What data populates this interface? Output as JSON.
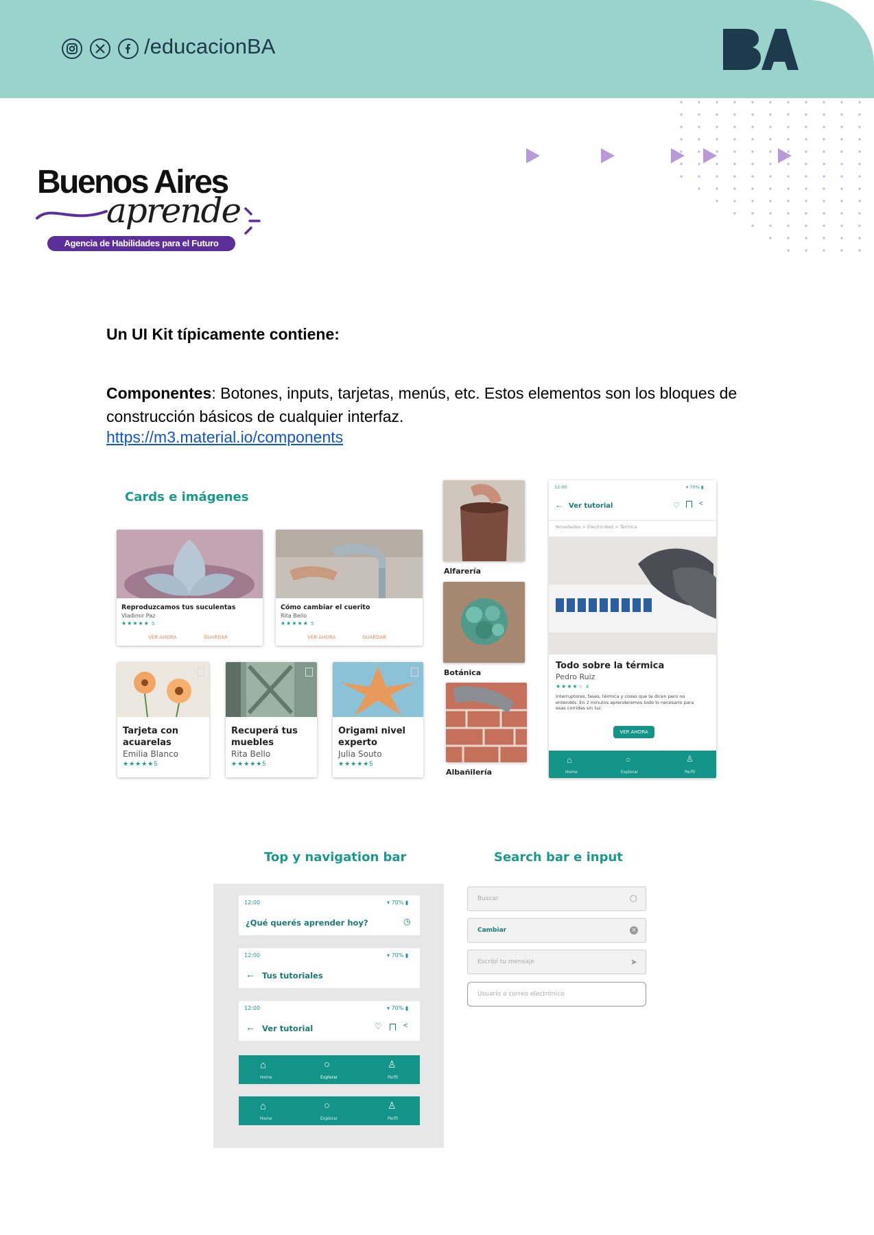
{
  "header": {
    "social_icons": [
      "instagram-icon",
      "x-icon",
      "facebook-icon"
    ],
    "handle": "/educacionBA",
    "logo": "BA"
  },
  "brand": {
    "title": "Buenos Aires",
    "script": "aprende",
    "tagline": "Agencia de Habilidades para el Futuro"
  },
  "content": {
    "heading": "Un UI Kit típicamente contiene:",
    "term": "Componentes",
    "definition": ": Botones, inputs, tarjetas, menús, etc. Estos elementos son los bloques de construcción básicos de cualquier interfaz.",
    "link": "https://m3.material.io/components"
  },
  "cards_section": {
    "title": "Cards e imágenes",
    "wide_cards": [
      {
        "title": "Reproduzcamos tus suculentas",
        "author": "Vladimir Paz",
        "rating": "5",
        "action1": "VER AHORA",
        "action2": "GUARDAR"
      },
      {
        "title": "Cómo cambiar el cuerito",
        "author": "Rita Bello",
        "rating": "5",
        "action1": "VER AHORA",
        "action2": "GUARDAR"
      }
    ],
    "small_cards": [
      {
        "title": "Tarjeta con acuarelas",
        "author": "Emilia Blanco",
        "rating": "5"
      },
      {
        "title": "Recuperá tus muebles",
        "author": "Rita Bello",
        "rating": "5"
      },
      {
        "title": "Origami nivel experto",
        "author": "Julia Souto",
        "rating": "5"
      }
    ],
    "categories": [
      "Alfarería",
      "Botánica",
      "Albañilería"
    ],
    "phone": {
      "time": "12:00",
      "battery": "70%",
      "back_label": "Ver tutorial",
      "breadcrumb": "Novedades > Electricidad > Térmica",
      "title": "Todo sobre la térmica",
      "author": "Pedro Ruiz",
      "rating": "4",
      "description": "Interruptores, fases, térmica y cosas que te dicen pero no entendés. En 2 minutos aprenderemos todo lo necesario para esas corridas sin luz.",
      "button": "VER AHORA",
      "nav": [
        "Home",
        "Explorar",
        "Perfil"
      ]
    }
  },
  "nav_section": {
    "title": "Top y navigation bar",
    "bars": [
      {
        "time": "12:00",
        "battery": "70%",
        "label": "¿Qué querés aprender hoy?"
      },
      {
        "time": "12:00",
        "battery": "70%",
        "label": "Tus tutoriales"
      },
      {
        "time": "12:00",
        "battery": "70%",
        "label": "Ver tutorial"
      }
    ],
    "nav_labels": [
      "Home",
      "Explorar",
      "Perfil"
    ]
  },
  "search_section": {
    "title": "Search bar e input",
    "inputs": [
      {
        "text": "Buscar",
        "icon": "search-icon"
      },
      {
        "text": "Cambiar",
        "icon": "clear-icon"
      },
      {
        "text": "Escribí tu mensaje",
        "icon": "send-icon"
      },
      {
        "text": "Usuario o correo electrónico",
        "icon": ""
      }
    ]
  },
  "colors": {
    "band": "#9ad2cc",
    "navy": "#1e3a4d",
    "teal": "#149488",
    "purple": "#5b2e9a",
    "triangles": "#b99ad8",
    "link": "#1155cc"
  }
}
